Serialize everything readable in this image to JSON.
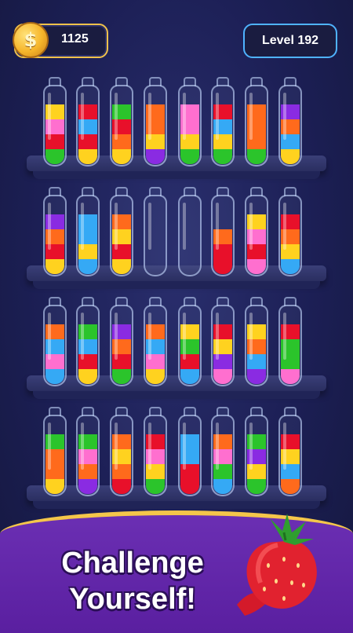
{
  "hud": {
    "coins": "1125",
    "coin_symbol": "$",
    "level": "Level 192"
  },
  "colors": {
    "y": "#ffd21f",
    "p": "#ff6fcf",
    "r": "#e8102a",
    "g": "#2bc42b",
    "b": "#35a9f5",
    "o": "#ff6a1c",
    "v": "#8a2be2"
  },
  "shelves": [
    {
      "bottles": [
        [
          "g",
          "r",
          "p",
          "y"
        ],
        [
          "y",
          "r",
          "b",
          "r"
        ],
        [
          "y",
          "o",
          "r",
          "g"
        ],
        [
          "v",
          "y",
          "o",
          "o"
        ],
        [
          "g",
          "y",
          "p",
          "p"
        ],
        [
          "g",
          "y",
          "b",
          "r"
        ],
        [
          "g",
          "o",
          "o",
          "o"
        ],
        [
          "y",
          "b",
          "o",
          "v"
        ]
      ]
    },
    {
      "bottles": [
        [
          "y",
          "r",
          "o",
          "v"
        ],
        [
          "b",
          "y",
          "b",
          "b"
        ],
        [
          "y",
          "r",
          "y",
          "o"
        ],
        [],
        [],
        [
          "r",
          "r",
          "o"
        ],
        [
          "p",
          "r",
          "p",
          "y"
        ],
        [
          "b",
          "y",
          "o",
          "r"
        ]
      ]
    },
    {
      "bottles": [
        [
          "b",
          "p",
          "b",
          "o"
        ],
        [
          "y",
          "r",
          "b",
          "g"
        ],
        [
          "g",
          "r",
          "o",
          "v"
        ],
        [
          "y",
          "p",
          "b",
          "o"
        ],
        [
          "b",
          "r",
          "g",
          "y"
        ],
        [
          "p",
          "v",
          "y",
          "r"
        ],
        [
          "v",
          "b",
          "o",
          "y"
        ],
        [
          "p",
          "g",
          "g",
          "r"
        ]
      ]
    },
    {
      "bottles": [
        [
          "y",
          "o",
          "o",
          "g"
        ],
        [
          "v",
          "o",
          "p",
          "g"
        ],
        [
          "r",
          "o",
          "y",
          "o"
        ],
        [
          "g",
          "y",
          "p",
          "r"
        ],
        [
          "r",
          "r",
          "b",
          "b"
        ],
        [
          "b",
          "g",
          "p",
          "o"
        ],
        [
          "g",
          "y",
          "v",
          "g"
        ],
        [
          "o",
          "b",
          "y",
          "r"
        ]
      ]
    }
  ],
  "banner": {
    "tagline_line1": "Challenge",
    "tagline_line2": "Yourself!"
  }
}
